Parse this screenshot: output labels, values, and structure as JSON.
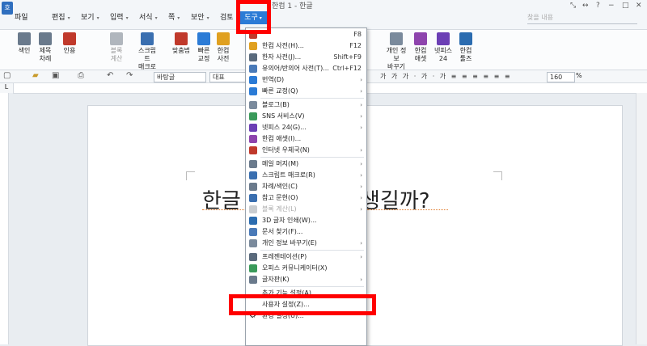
{
  "window": {
    "title": "한컴 1 - 한글",
    "controls": [
      "⤡",
      "↔",
      "?",
      "−",
      "□",
      "✕"
    ]
  },
  "menubar": {
    "file": "파일",
    "items": [
      "편집",
      "보기",
      "입력",
      "서식",
      "쪽",
      "보안",
      "검토"
    ],
    "tool": "도구",
    "help_placeholder": "찾을 내용"
  },
  "ribbon": {
    "items": [
      {
        "label": "색인",
        "sub": "",
        "icon": "index-icon"
      },
      {
        "label": "제목",
        "sub": "차례",
        "icon": "toc-icon"
      },
      {
        "label": "인용",
        "sub": "",
        "icon": "citation-icon"
      },
      {
        "label": "블록",
        "sub": "계산",
        "icon": "block-calc-icon",
        "disabled": true
      },
      {
        "label": "스크립트",
        "sub": "매크로",
        "icon": "script-macro-icon"
      },
      {
        "label": "맞춤법",
        "sub": "",
        "icon": "spellcheck-icon"
      },
      {
        "label": "빠른",
        "sub": "교정",
        "icon": "quick-correct-icon"
      },
      {
        "label": "한컴",
        "sub": "사전",
        "icon": "hancom-dict-icon"
      },
      {
        "label": "개인 정보",
        "sub": "바꾸기",
        "icon": "privacy-icon"
      },
      {
        "label": "한컴",
        "sub": "애셋",
        "icon": "hancom-asset-icon"
      },
      {
        "label": "넷피스",
        "sub": "24",
        "icon": "netffice-icon"
      },
      {
        "label": "한컴",
        "sub": "툴즈",
        "icon": "hancom-tools-icon"
      }
    ]
  },
  "toolbar": {
    "style": "바탕글",
    "font": "대표",
    "zoom": "160",
    "zoom_unit": "%"
  },
  "document": {
    "text_left": "한글",
    "text_right": "생길까?"
  },
  "dropdown": {
    "items": [
      {
        "label": "",
        "shortcut": "F8",
        "icon": "spellcheck-icon"
      },
      {
        "label": "한컴 사전(H)...",
        "shortcut": "F12",
        "icon": "hancom-dict-icon"
      },
      {
        "label": "한자 사전(J)...",
        "shortcut": "Shift+F9",
        "icon": "hanja-dict-icon"
      },
      {
        "label": "유의어/반의어 사전(T)...",
        "shortcut": "Ctrl+F12",
        "icon": "thesaurus-icon"
      },
      {
        "label": "번역(D)",
        "submenu": true,
        "icon": "translate-icon"
      },
      {
        "label": "빠른 교정(Q)",
        "submenu": true,
        "icon": "quick-correct-icon"
      },
      {
        "sep": true
      },
      {
        "label": "블로그(B)",
        "submenu": true,
        "icon": "blog-icon"
      },
      {
        "label": "SNS 서비스(V)",
        "submenu": true,
        "icon": "sns-icon"
      },
      {
        "label": "넷피스 24(G)...",
        "submenu": true,
        "icon": "netffice-icon"
      },
      {
        "label": "한컴 애셋(I)...",
        "icon": "hancom-asset-icon"
      },
      {
        "label": "인터넷 우체국(N)",
        "submenu": true,
        "icon": "post-office-icon"
      },
      {
        "sep": true
      },
      {
        "label": "메일 머지(M)",
        "submenu": true,
        "icon": "mail-merge-icon"
      },
      {
        "label": "스크립트 매크로(R)",
        "submenu": true,
        "icon": "script-macro-icon"
      },
      {
        "label": "차례/색인(C)",
        "submenu": true,
        "icon": "toc-icon"
      },
      {
        "label": "참고 문헌(O)",
        "submenu": true,
        "icon": "bibliography-icon"
      },
      {
        "label": "블록 계산(L)",
        "submenu": true,
        "disabled": true,
        "icon": "block-calc-icon"
      },
      {
        "label": "3D 글자 인쇄(W)...",
        "icon": "3d-print-icon"
      },
      {
        "label": "문서 찾기(F)...",
        "icon": "doc-search-icon"
      },
      {
        "label": "개인 정보 바꾸기(E)",
        "submenu": true,
        "icon": "privacy-icon"
      },
      {
        "sep": true
      },
      {
        "label": "프레젠테이션(P)",
        "submenu": true,
        "icon": "presentation-icon"
      },
      {
        "label": "오피스 커뮤니케이터(X)",
        "icon": "communicator-icon"
      },
      {
        "label": "글자판(K)",
        "submenu": true,
        "icon": "keyboard-icon"
      },
      {
        "sep": true
      },
      {
        "label": "추가 기능 설정(A)...",
        "icon": ""
      },
      {
        "label": "사용자 설정(Z)...",
        "icon": ""
      },
      {
        "label": "환경 설정(U)...",
        "icon": "gear-icon"
      },
      {
        "label": "",
        "icon": ""
      }
    ]
  },
  "colors": {
    "accent": "#2b7bd6",
    "highlight": "#ff0000"
  }
}
